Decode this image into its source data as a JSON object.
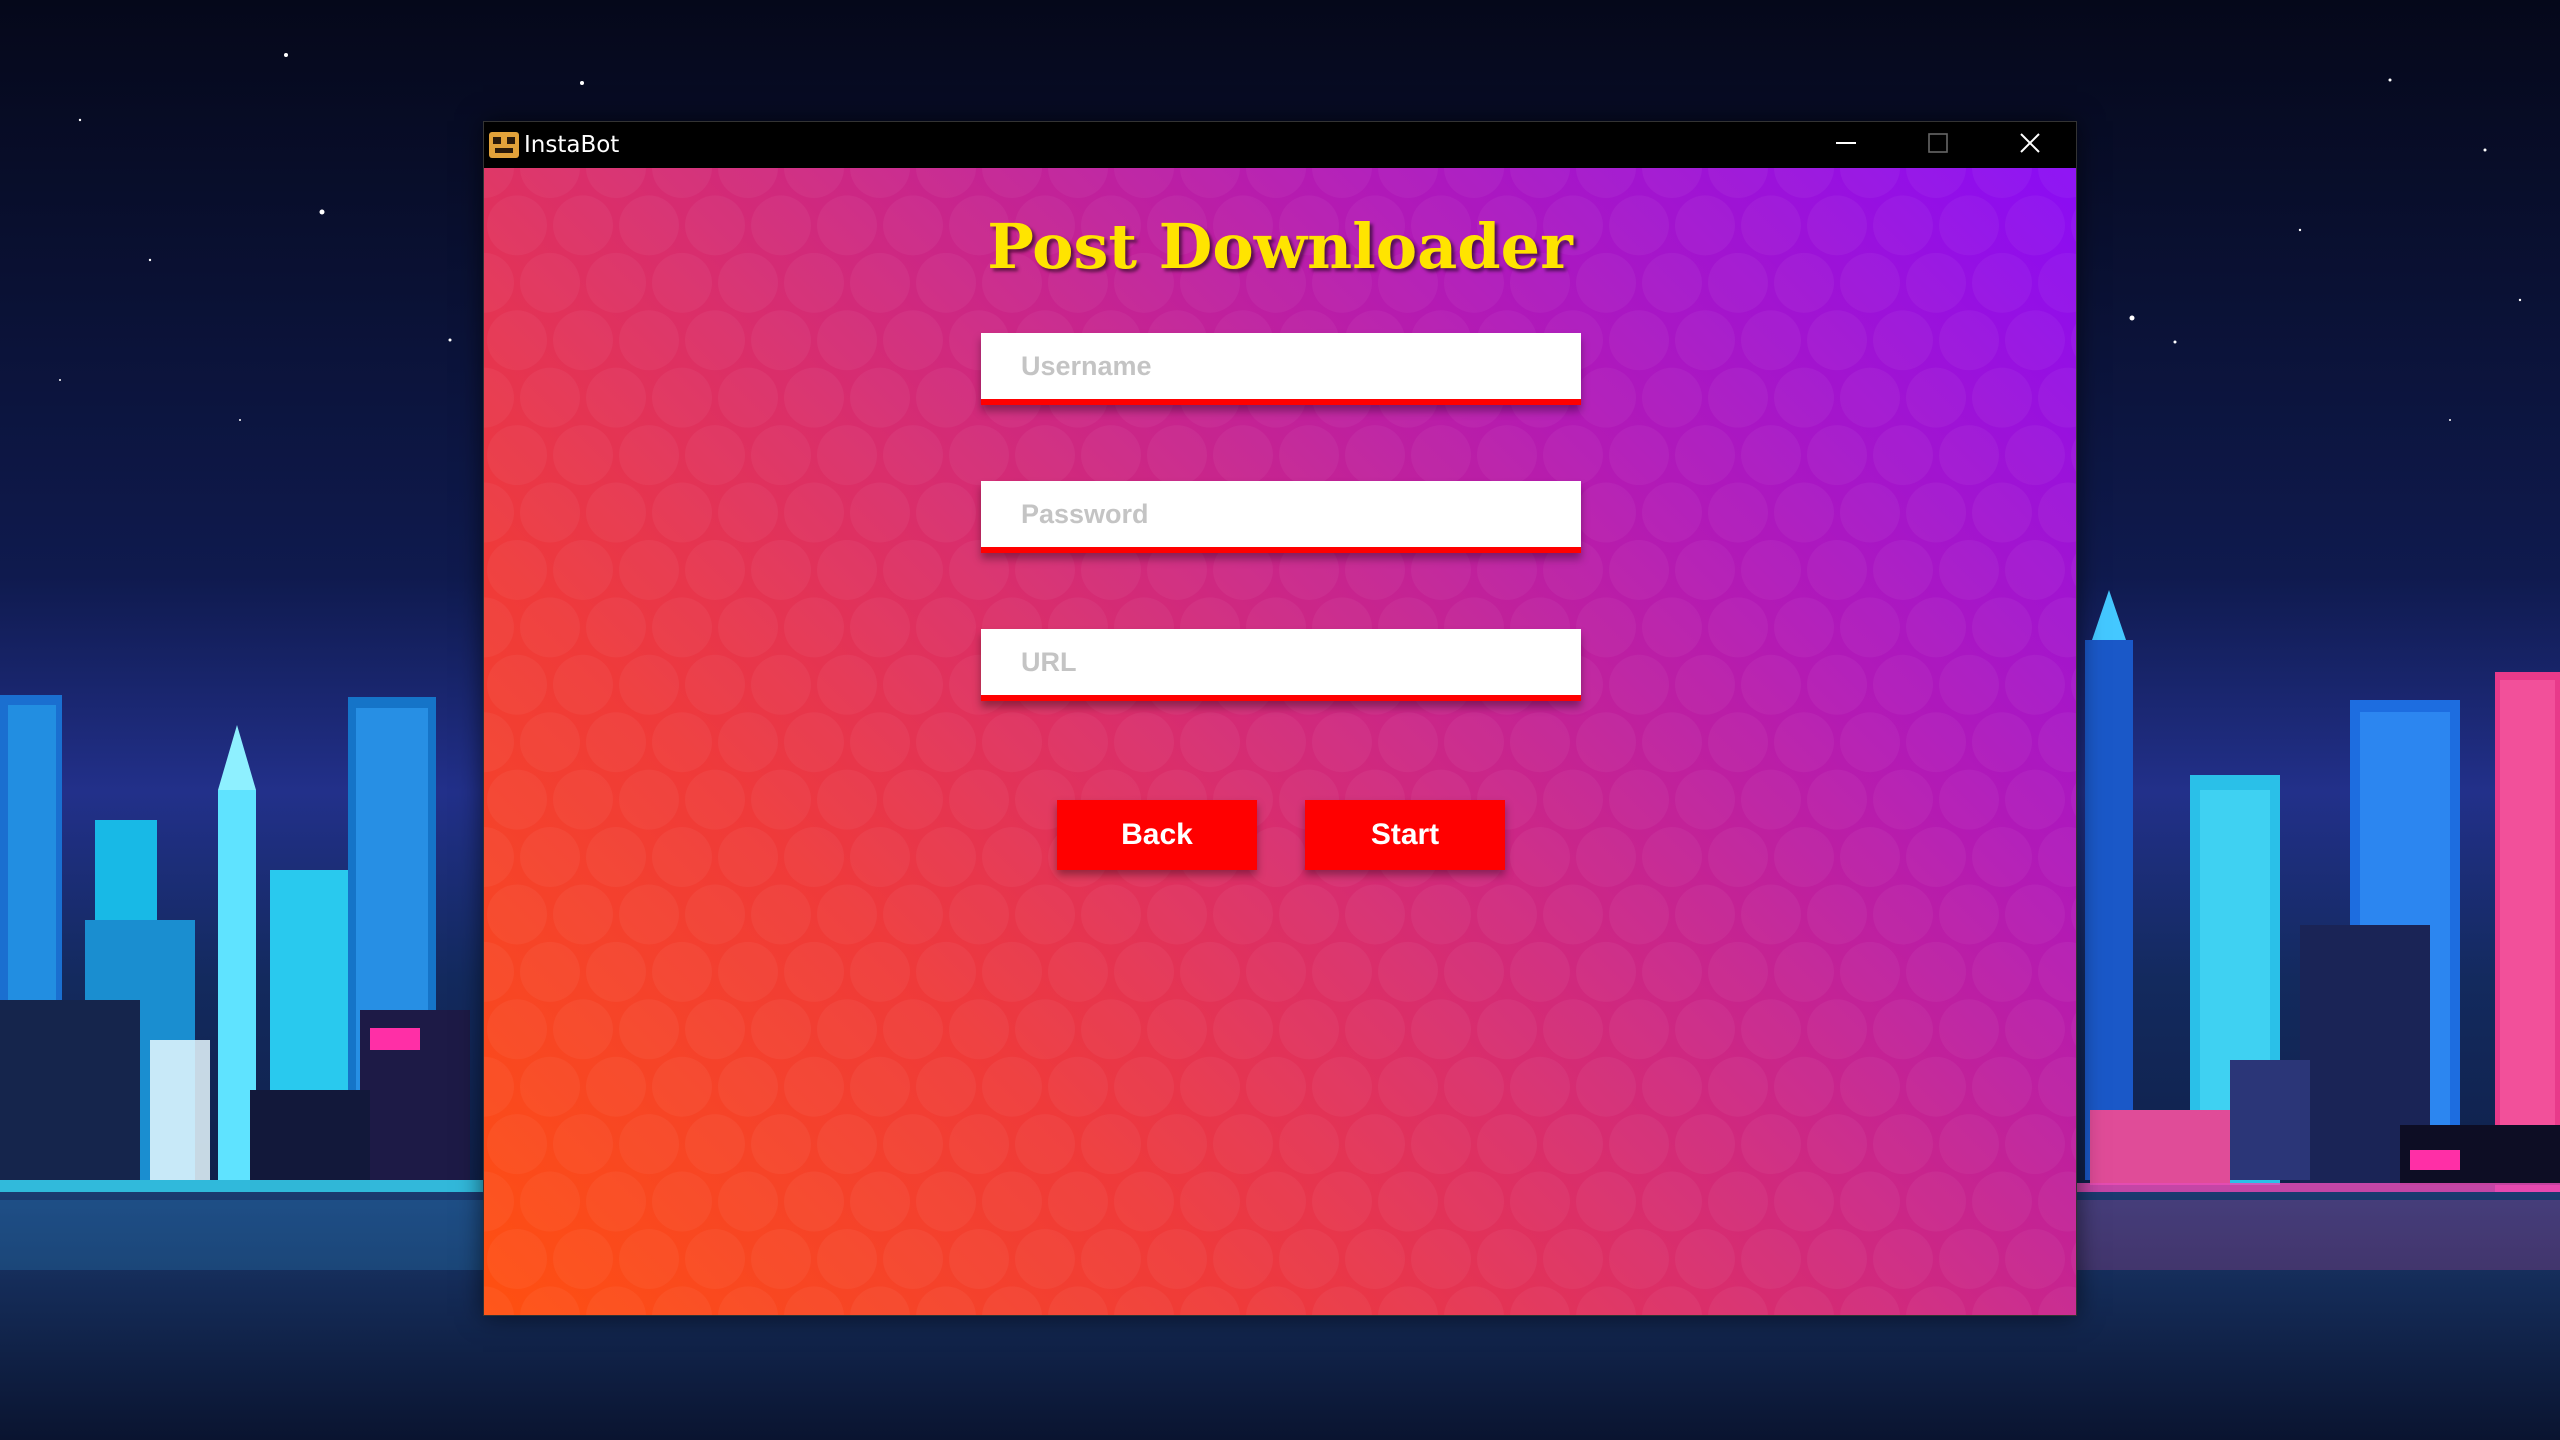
{
  "window": {
    "title": "InstaBot",
    "app_icon": "instabot-robot-icon",
    "controls": {
      "minimize_icon": "minimize-icon",
      "maximize_icon": "maximize-icon",
      "close_icon": "close-icon"
    }
  },
  "main": {
    "heading": "Post Downloader",
    "fields": {
      "username": {
        "placeholder": "Username",
        "value": ""
      },
      "password": {
        "placeholder": "Password",
        "value": ""
      },
      "url": {
        "placeholder": "URL",
        "value": ""
      }
    },
    "buttons": {
      "back_label": "Back",
      "start_label": "Start"
    }
  },
  "colors": {
    "heading": "#ffe400",
    "button": "#ff0000",
    "field_underline": "#ff0000",
    "gradient_top_right": "#8a0cf5",
    "gradient_bottom_left": "#ff5010"
  }
}
